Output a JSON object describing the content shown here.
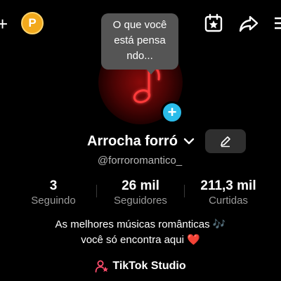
{
  "header": {
    "coin_label": "P",
    "icons": [
      "plus-icon",
      "coin-icon",
      "calendar-star-icon",
      "share-icon",
      "menu-icon"
    ]
  },
  "avatar": {
    "icon": "music-note-icon",
    "add_button": "+"
  },
  "bubble": {
    "lines": [
      "O que você",
      "está pensa",
      "ndo..."
    ]
  },
  "profile": {
    "name": "Arrocha forró",
    "handle": "@forroromantico_"
  },
  "stats": [
    {
      "value": "3",
      "label": "Seguindo"
    },
    {
      "value": "26 mil",
      "label": "Seguidores"
    },
    {
      "value": "211,3 mil",
      "label": "Curtidas"
    }
  ],
  "bio": {
    "line1": "As melhores músicas românticas 🎶",
    "line2": "você só encontra aqui ❤️"
  },
  "studio": {
    "label": "TikTok Studio"
  },
  "colors": {
    "accent_blue": "#2bbcea",
    "coin": "#f2a91c",
    "neon_red": "#ff2a2a",
    "background": "#000000"
  }
}
